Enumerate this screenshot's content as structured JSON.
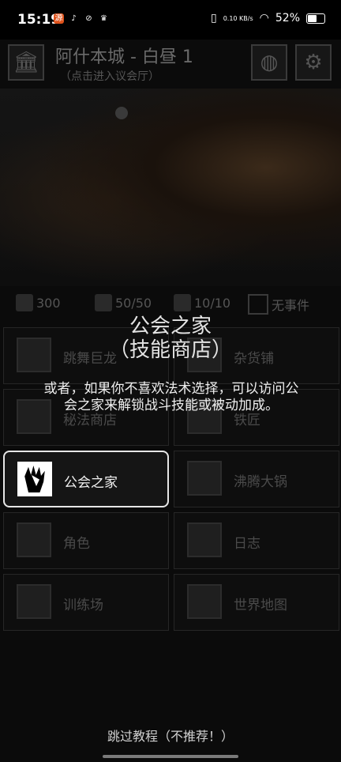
{
  "status_bar": {
    "time": "15:19",
    "net_speed": "0.10 KB/s",
    "battery": "52%"
  },
  "header": {
    "title": "阿什本城 - 白昼 1",
    "subtitle": "（点击进入议会厅）"
  },
  "stats": {
    "gold": "300",
    "food": "50/50",
    "brain": "10/10",
    "event": "无事件"
  },
  "menu": [
    {
      "label": "跳舞巨龙",
      "icon": "beer-mug-icon"
    },
    {
      "label": "杂货铺",
      "icon": "shop-icon"
    },
    {
      "label": "秘法商店",
      "icon": "spellbook-icon"
    },
    {
      "label": "铁匠",
      "icon": "anvil-icon"
    },
    {
      "label": "公会之家",
      "icon": "gauntlet-icon"
    },
    {
      "label": "沸腾大锅",
      "icon": "cauldron-icon"
    },
    {
      "label": "角色",
      "icon": "helmet-icon"
    },
    {
      "label": "日志",
      "icon": "scroll-icon"
    },
    {
      "label": "训练场",
      "icon": "swords-icon"
    },
    {
      "label": "世界地图",
      "icon": "map-icon"
    }
  ],
  "tutorial": {
    "title_line1": "公会之家",
    "title_line2": "（技能商店）",
    "body": "或者，如果你不喜欢法术选择，可以访问公会之家来解锁战斗技能或被动加成。",
    "skip": "跳过教程（不推荐！）"
  }
}
